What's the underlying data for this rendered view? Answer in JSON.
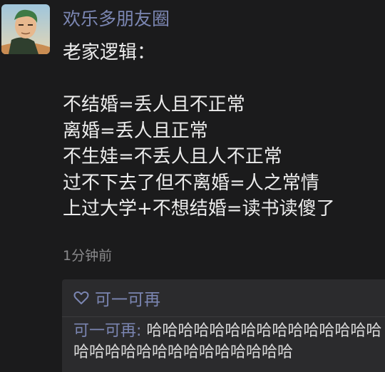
{
  "post": {
    "username": "欢乐多朋友圈",
    "lines": [
      "老家逻辑：",
      "",
      "不结婚=丢人且不正常",
      "离婚=丢人且正常",
      "不生娃=不丢人且人不正常",
      "过不下去了但不离婚=人之常情",
      "上过大学+不想结婚=读书读傻了"
    ],
    "timestamp": "1分钟前"
  },
  "comments": {
    "likes": "可一可再",
    "items": [
      {
        "author": "可一可再:",
        "text": " 哈哈哈哈哈哈哈哈哈哈哈哈哈哈哈哈哈哈哈哈哈哈哈哈哈哈哈哈哈"
      }
    ]
  },
  "colors": {
    "background": "#1b1b1c",
    "name_link": "#7b86b2",
    "comment_panel": "#2b2b2d"
  }
}
